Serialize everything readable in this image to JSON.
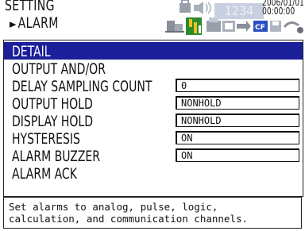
{
  "header": {
    "title": "SETTING",
    "subtitle": "ALARM",
    "subtitle_arrow": "►",
    "counter": "1234",
    "date": "2006/01/01",
    "time": "00:00:00"
  },
  "status_icons": [
    "lock-icon",
    "speaker-icon",
    "network-icon",
    "printer-icon",
    "folder-icon",
    "cf-card-icon",
    "disk-icon",
    "swap-icon"
  ],
  "menu": {
    "rows": [
      {
        "label": "DETAIL",
        "selected": true
      },
      {
        "label": "OUTPUT AND/OR"
      },
      {
        "label": "DELAY SAMPLING COUNT",
        "value": "0"
      },
      {
        "label": "OUTPUT HOLD",
        "value": "NONHOLD"
      },
      {
        "label": "DISPLAY HOLD",
        "value": "NONHOLD"
      },
      {
        "label": "HYSTERESIS",
        "value": "ON"
      },
      {
        "label": "ALARM BUZZER",
        "value": "ON"
      },
      {
        "label": "ALARM ACK"
      }
    ]
  },
  "help": {
    "line1": "Set alarms to analog, pulse, logic,",
    "line2": "calculation, and communication channels."
  },
  "colors": {
    "selection": "#1b1f99",
    "accent_green": "#2a8a2a",
    "accent_blue": "#2b4fc0"
  }
}
